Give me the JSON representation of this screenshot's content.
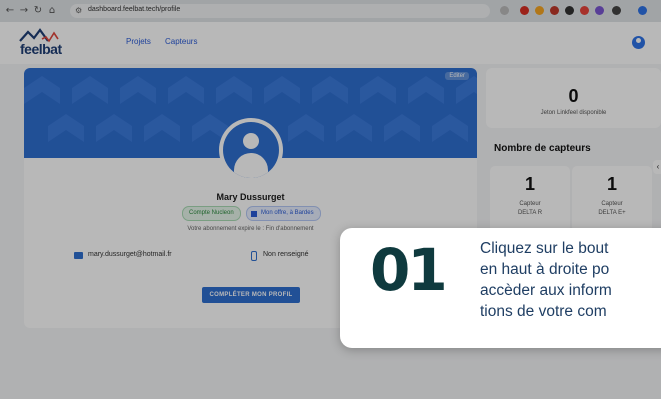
{
  "browser": {
    "url": "dashboard.feelbat.tech/profile",
    "nav_back": "←",
    "nav_forward": "→",
    "nav_reload": "↻",
    "nav_home": "⌂",
    "extension_colors": [
      "#d93025",
      "#f5a623",
      "#c0392b",
      "#333333",
      "#e8453c",
      "#7b57d1",
      "#444444",
      "#2f73e8"
    ]
  },
  "header": {
    "logo_text": "feelbat",
    "nav": [
      "Projets",
      "Capteurs"
    ]
  },
  "profile": {
    "banner_tag": "Editer",
    "name": "Mary Dussurget",
    "badge_account": "Compte Nucleon",
    "badge_plan": "Mon offre, à Bardes",
    "subscription_text": "Votre abonnement expire le : Fin d'abonnement",
    "email": "mary.dussurget@hotmail.fr",
    "phone": "Non renseigné",
    "complete_button": "COMPLÉTER MON PROFIL"
  },
  "side": {
    "token_count": "0",
    "token_label": "Jeton Linkfeel disponible",
    "sensors_title": "Nombre de capteurs",
    "sensors": [
      {
        "count": "1",
        "label": "Capteur",
        "model": "DELTA R"
      },
      {
        "count": "1",
        "label": "Capteur",
        "model": "DELTA E+"
      }
    ],
    "scroll_arrow": "‹"
  },
  "callout": {
    "step": "01",
    "lines": [
      "Cliquez sur le bout",
      "en haut à droite po",
      "accèder aux inform",
      "tions de votre com"
    ]
  },
  "colors": {
    "brand_blue": "#2f6fd0",
    "callout_number": "#0f3a3e",
    "callout_text": "#1f3e63"
  }
}
